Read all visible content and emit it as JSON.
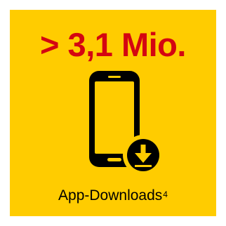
{
  "tile": {
    "headline": "> 3,1 Mio.",
    "caption": "App-Downloads",
    "footnote": "4"
  },
  "icons": {
    "main": "smartphone-icon",
    "badge": "download-arrow-icon"
  },
  "colors": {
    "background": "#ffcc00",
    "headline": "#d40511",
    "text": "#000000"
  }
}
